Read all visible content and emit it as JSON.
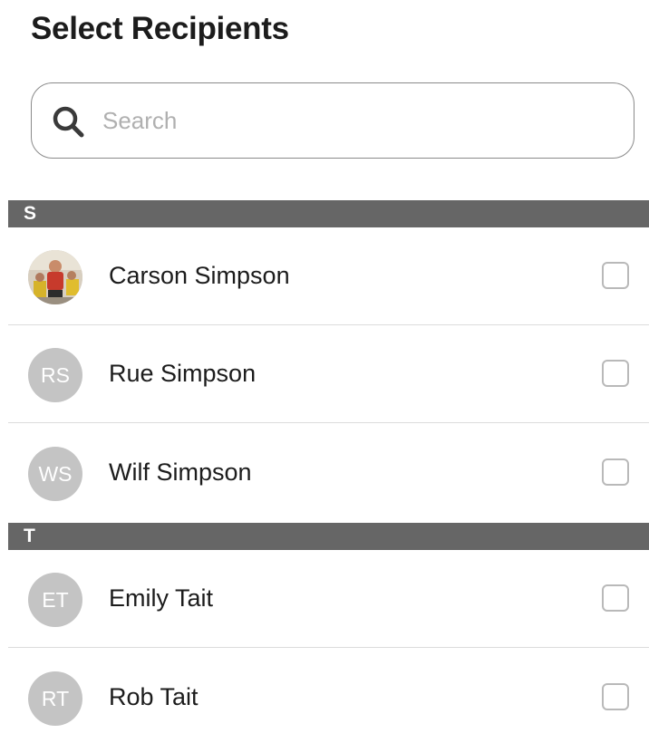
{
  "header": {
    "title": "Select Recipients"
  },
  "search": {
    "placeholder": "Search",
    "value": "",
    "icon": "search-icon"
  },
  "sections": [
    {
      "letter": "S",
      "contacts": [
        {
          "name": "Carson Simpson",
          "initials": "",
          "has_photo": true,
          "checked": false
        },
        {
          "name": "Rue Simpson",
          "initials": "RS",
          "has_photo": false,
          "checked": false
        },
        {
          "name": "Wilf Simpson",
          "initials": "WS",
          "has_photo": false,
          "checked": false
        }
      ]
    },
    {
      "letter": "T",
      "contacts": [
        {
          "name": "Emily Tait",
          "initials": "ET",
          "has_photo": false,
          "checked": false
        },
        {
          "name": "Rob Tait",
          "initials": "RT",
          "has_photo": false,
          "checked": false
        }
      ]
    }
  ],
  "colors": {
    "section_header_bg": "#666666",
    "avatar_bg": "#c4c4c4",
    "checkbox_border": "#b9b9b9"
  }
}
